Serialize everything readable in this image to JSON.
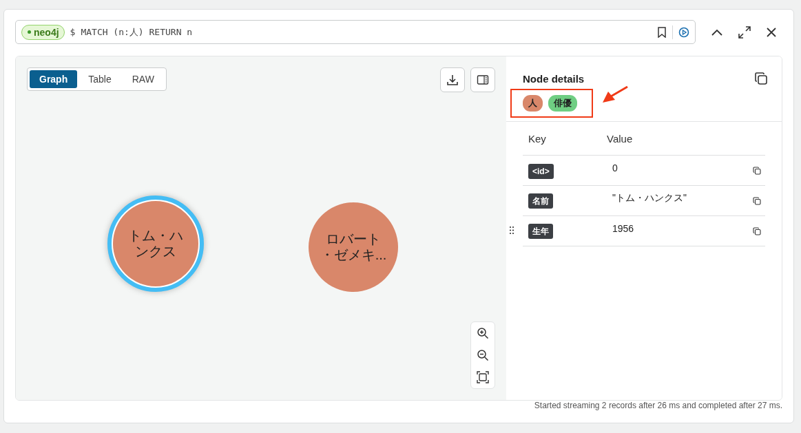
{
  "query_bar": {
    "db_badge": "neo4j",
    "prompt": "$",
    "query": "MATCH (n:人) RETURN n"
  },
  "view_tabs": [
    {
      "label": "Graph",
      "selected": true
    },
    {
      "label": "Table",
      "selected": false
    },
    {
      "label": "RAW",
      "selected": false
    }
  ],
  "graph": {
    "nodes": [
      {
        "label_lines": [
          "トム・ハ",
          "ンクス"
        ],
        "selected": true,
        "color": "#d9876a"
      },
      {
        "label_lines": [
          "ロバート",
          "・ゼメキ..."
        ],
        "selected": false,
        "color": "#d9876a"
      }
    ]
  },
  "details": {
    "title": "Node details",
    "labels": [
      {
        "text": "人",
        "color": "#d9876a"
      },
      {
        "text": "俳優",
        "color": "#6fce83"
      }
    ],
    "columns": [
      "Key",
      "Value"
    ],
    "rows": [
      {
        "key": "<id>",
        "value": "0"
      },
      {
        "key": "名前",
        "value": "\"トム・ハンクス\""
      },
      {
        "key": "生年",
        "value": "1956"
      }
    ]
  },
  "status": "Started streaming 2 records after 26 ms and completed after 27 ms."
}
